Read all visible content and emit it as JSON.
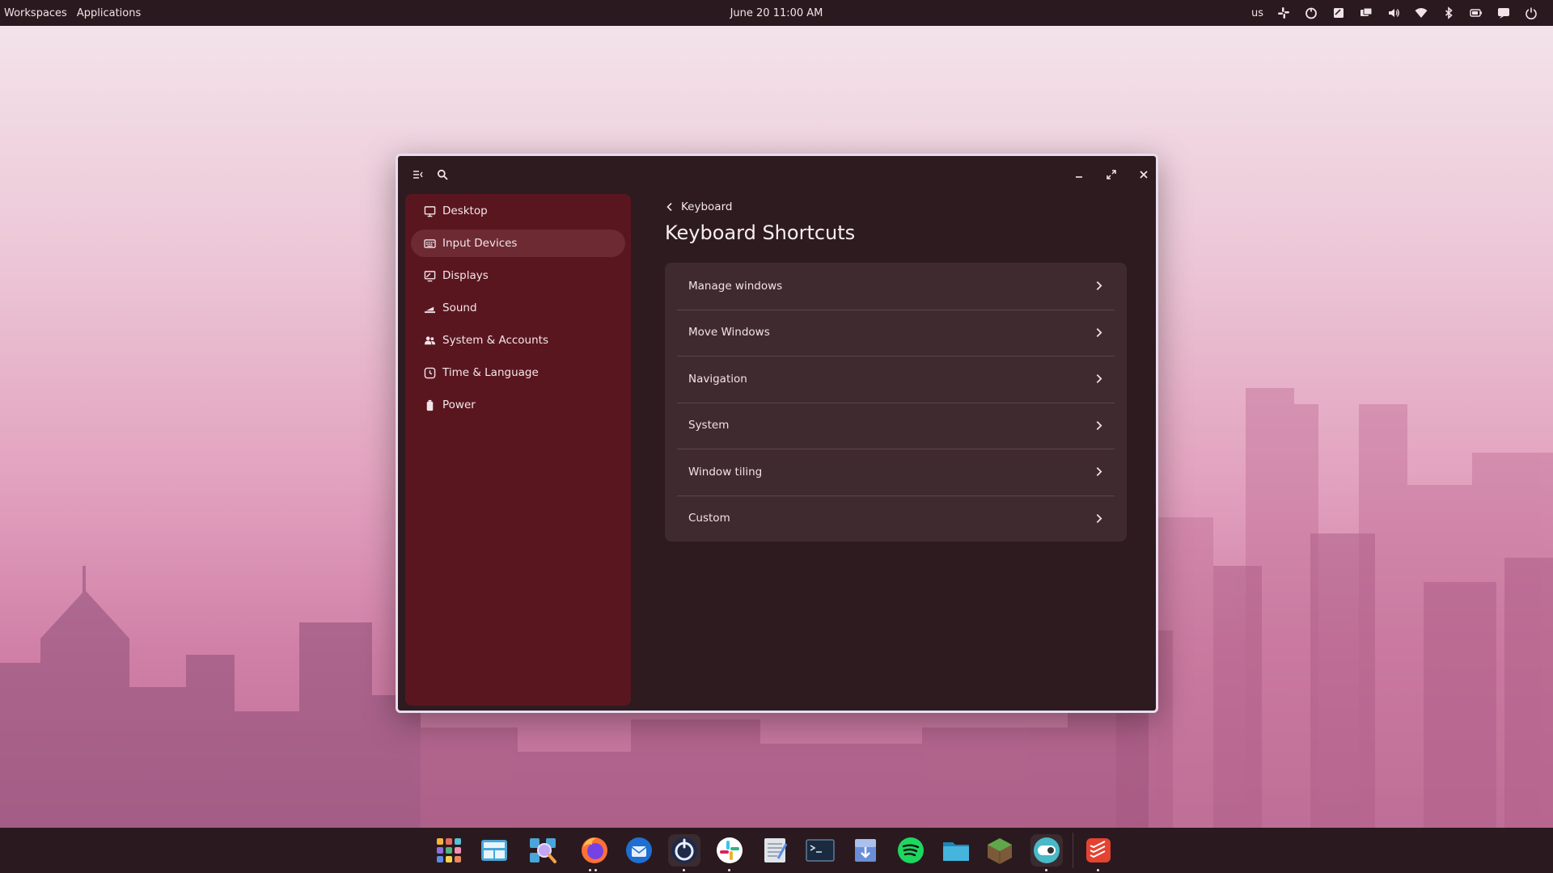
{
  "top_panel": {
    "workspaces": "Workspaces",
    "applications": "Applications",
    "clock": "June 20 11:00 AM",
    "keyboard_layout": "us",
    "tray_icons": [
      "slack-tray-icon",
      "timer-tray-icon",
      "notes-tray-icon",
      "display-tray-icon",
      "volume-icon",
      "wifi-icon",
      "bluetooth-icon",
      "battery-icon",
      "notifications-icon",
      "power-icon"
    ]
  },
  "window": {
    "sidebar": {
      "items": [
        {
          "label": "Desktop",
          "icon": "monitor-icon"
        },
        {
          "label": "Input Devices",
          "icon": "keyboard-icon",
          "active": true
        },
        {
          "label": "Displays",
          "icon": "display-icon"
        },
        {
          "label": "Sound",
          "icon": "sound-icon"
        },
        {
          "label": "System & Accounts",
          "icon": "users-icon"
        },
        {
          "label": "Time & Language",
          "icon": "clock-icon"
        },
        {
          "label": "Power",
          "icon": "battery-icon"
        }
      ]
    },
    "content": {
      "back_label": "Keyboard",
      "title": "Keyboard Shortcuts",
      "rows": [
        {
          "label": "Manage windows"
        },
        {
          "label": "Move Windows"
        },
        {
          "label": "Navigation"
        },
        {
          "label": "System"
        },
        {
          "label": "Window tiling"
        },
        {
          "label": "Custom"
        }
      ]
    }
  },
  "dock": {
    "apps": [
      "app-library",
      "workspaces-overview",
      "app-search",
      "firefox",
      "thunderbird",
      "timer-app",
      "slack",
      "text-editor",
      "terminal",
      "installer",
      "spotify",
      "files",
      "minecraft",
      "settings",
      "todoist"
    ]
  },
  "colors": {
    "panel": "#2a1a1f",
    "window_bg": "#2d1b20",
    "sidebar_bg": "#5a161f",
    "sidebar_active": "#6d2a33",
    "list_bg": "#3f2a2f"
  }
}
